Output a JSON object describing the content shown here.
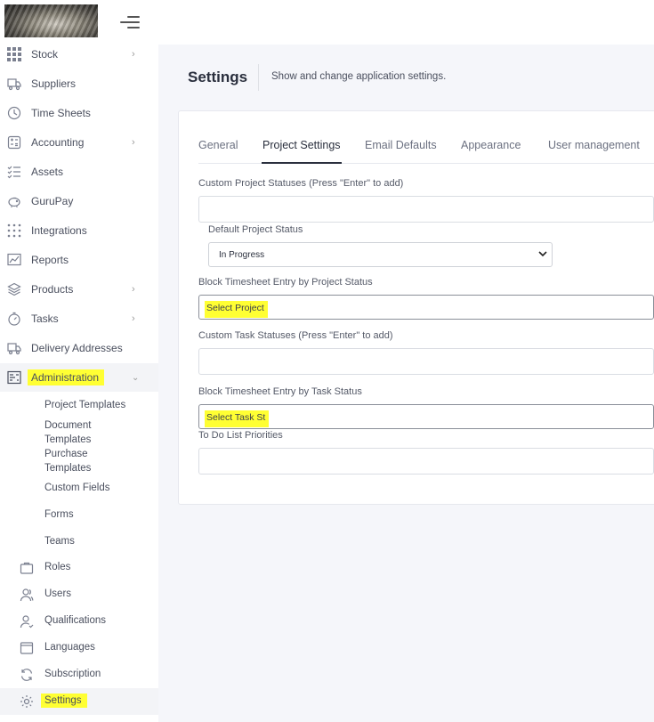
{
  "sidebar": {
    "items": [
      {
        "label": "Stock",
        "icon": "grid-icon",
        "has_chevron": true
      },
      {
        "label": "Suppliers",
        "icon": "truck-icon",
        "has_chevron": false
      },
      {
        "label": "Time Sheets",
        "icon": "clock-icon",
        "has_chevron": false
      },
      {
        "label": "Accounting",
        "icon": "calculator-icon",
        "has_chevron": true
      },
      {
        "label": "Assets",
        "icon": "checklist-icon",
        "has_chevron": false
      },
      {
        "label": "GuruPay",
        "icon": "piggy-bank-icon",
        "has_chevron": false
      },
      {
        "label": "Integrations",
        "icon": "dots-grid-icon",
        "has_chevron": false
      },
      {
        "label": "Reports",
        "icon": "chart-icon",
        "has_chevron": false
      },
      {
        "label": "Products",
        "icon": "layers-icon",
        "has_chevron": true
      },
      {
        "label": "Tasks",
        "icon": "stopwatch-icon",
        "has_chevron": true
      },
      {
        "label": "Delivery Addresses",
        "icon": "delivery-truck-icon",
        "has_chevron": false
      },
      {
        "label": "Administration",
        "icon": "admin-icon",
        "has_chevron": true,
        "expanded": true
      }
    ],
    "admin_sub": [
      "Project Templates",
      "Document Templates",
      "Purchase Templates",
      "Custom Fields",
      "Forms",
      "Teams"
    ],
    "admin_sub_icons": [
      {
        "label": "Roles",
        "icon": "briefcase-icon"
      },
      {
        "label": "Users",
        "icon": "users-icon"
      },
      {
        "label": "Qualifications",
        "icon": "qualification-icon"
      },
      {
        "label": "Languages",
        "icon": "window-icon"
      },
      {
        "label": "Subscription",
        "icon": "refresh-icon"
      },
      {
        "label": "Settings",
        "icon": "gear-icon"
      }
    ]
  },
  "header": {
    "title": "Settings",
    "subtitle": "Show and change application settings."
  },
  "tabs": [
    "General",
    "Project Settings",
    "Email Defaults",
    "Appearance",
    "User management"
  ],
  "active_tab": "Project Settings",
  "form": {
    "custom_project_statuses_label": "Custom Project Statuses (Press \"Enter\" to add)",
    "default_project_status_label": "Default Project Status",
    "default_project_status_value": "In Progress",
    "block_by_project_label": "Block Timesheet Entry by Project Status",
    "block_by_project_placeholder": "Select Project",
    "custom_task_statuses_label": "Custom Task Statuses (Press \"Enter\" to add)",
    "block_by_task_label": "Block Timesheet Entry by Task Status",
    "block_by_task_placeholder": "Select Task St",
    "todo_priorities_label": "To Do List Priorities"
  },
  "colors": {
    "highlight": "#ffff33",
    "sidebar_active": "#f3f4f7",
    "text": "#4a4f5e"
  }
}
